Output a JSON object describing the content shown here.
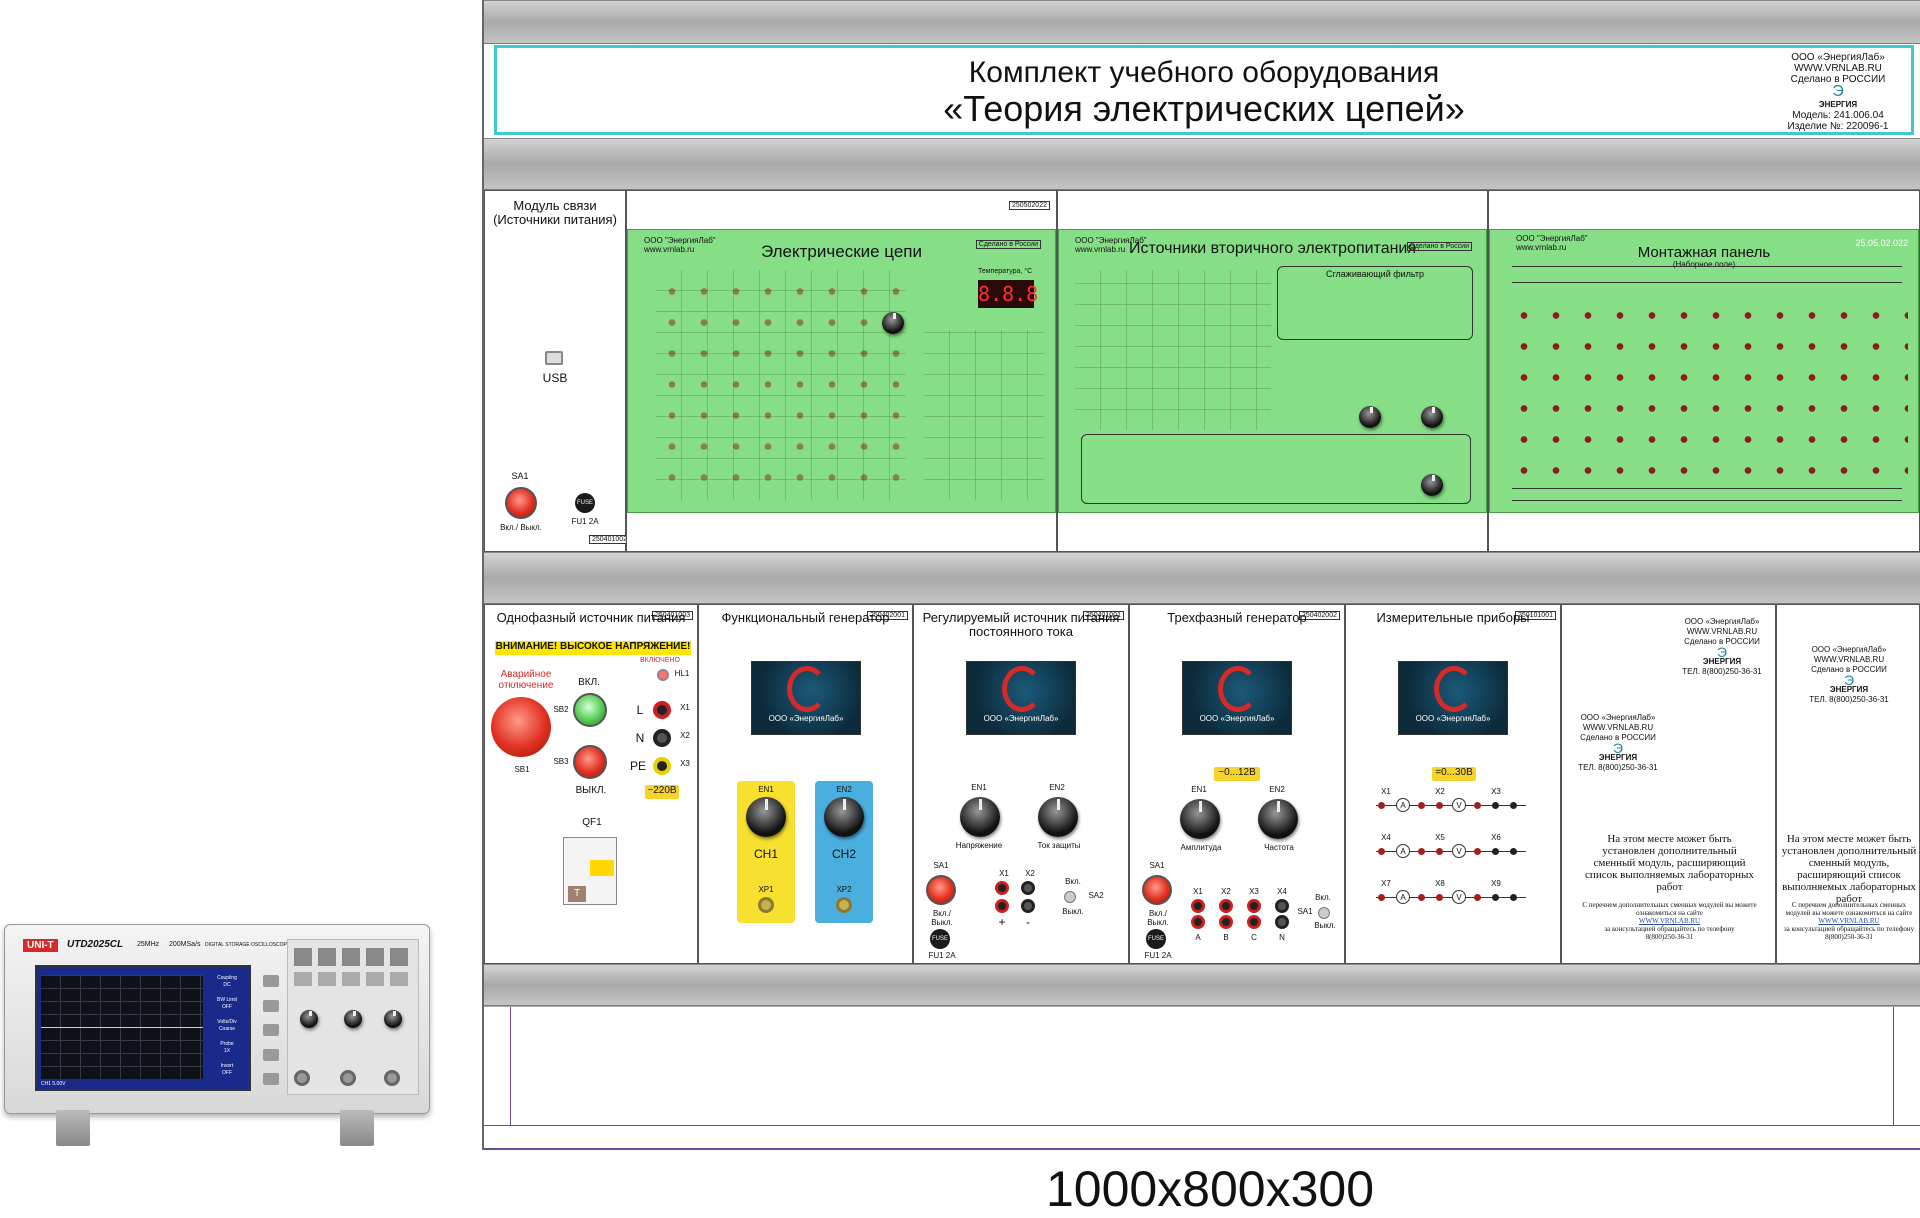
{
  "title": {
    "line1": "Комплект учебного оборудования",
    "line2": "«Теория электрических цепей»"
  },
  "company_block": {
    "name": "ООО «ЭнергияЛаб»",
    "site": "WWW.VRNLAB.RU",
    "made": "Сделано в РОССИИ",
    "brand": "ЭНЕРГИЯ",
    "model": "Модель: 241.006.04",
    "serial": "Изделие №: 220096-1"
  },
  "module_comm": {
    "title": "Модуль связи (Источники питания)",
    "usb": "USB",
    "sa1": "SA1",
    "sa1_state": "Вкл./ Выкл.",
    "fuse_label": "FU1 2А",
    "fuse_text": "FUSE",
    "code": "250401002"
  },
  "green_panels": [
    {
      "title": "Электрические цепи",
      "company": "ООО \"ЭнергияЛаб\" www.vrnlab.ru",
      "made": "Сделано в России",
      "code": "250502022",
      "temp": "8.8.8",
      "temp_label": "Температура, °С"
    },
    {
      "title": "Источники вторичного электропитания",
      "company": "ООО \"ЭнергияЛаб\" www.vrnlab.ru",
      "made": "Сделано в России",
      "filter": "Сглаживающий фильтр"
    },
    {
      "title": "Монтажная панель",
      "subtitle": "(Наборное поле)",
      "company": "ООО \"ЭнергияЛаб\" www.vrnlab.ru",
      "code": "25.05.02.022"
    }
  ],
  "single_phase": {
    "title": "Однофазный источник питания",
    "code": "250401003",
    "warning": "ВНИМАНИЕ!   ВЫСОКОЕ НАПРЯЖЕНИЕ!",
    "emergency": "Аварийное отключение",
    "on": "ВКЛ.",
    "off": "ВЫКЛ.",
    "sb1": "SB1",
    "sb2": "SB2",
    "sb3": "SB3",
    "indicator": "ВКЛЮЧЕНО",
    "hl1": "HL1",
    "l": "L",
    "n": "N",
    "pe": "PE",
    "x1": "X1",
    "x2": "X2",
    "x3": "X3",
    "voltage": "~220В",
    "qf1": "QF1",
    "t": "T"
  },
  "func_gen": {
    "title": "Функциональный генератор",
    "code": "250402001",
    "en1": "EN1",
    "en2": "EN2",
    "ch1": "CH1",
    "ch2": "CH2",
    "xp1": "XP1",
    "xp2": "XP2",
    "logo": "ООО «ЭнергияЛаб»"
  },
  "dc_source": {
    "title": "Регулируемый источник питания постоянного тока",
    "code": "250401001",
    "en1": "EN1",
    "en2": "EN2",
    "voltage": "Напряжение",
    "current": "Ток защиты",
    "sa1": "SA1",
    "sa1_state": "Вкл./ Выкл.",
    "x1": "X1",
    "x2": "X2",
    "plus": "+",
    "minus": "-",
    "sa2_on": "Вкл.",
    "sa2_off": "Выкл.",
    "sa2": "SA2",
    "fuse": "FU1 2А",
    "fuse_text": "FUSE",
    "logo": "ООО «ЭнергияЛаб»"
  },
  "three_phase": {
    "title": "Трехфазный генератор",
    "code": "250402002",
    "range": "~0...12В",
    "en1": "EN1",
    "en2": "EN2",
    "amp": "Амплитуда",
    "freq": "Частота",
    "sa1": "SA1",
    "sa1_state": "Вкл./ Выкл.",
    "xs": [
      "X1",
      "X2",
      "X3",
      "X4"
    ],
    "phases": [
      "A",
      "B",
      "C",
      "N"
    ],
    "sa_on": "Вкл.",
    "sa_off": "Выкл.",
    "sa1b": "SA1",
    "fuse": "FU1 2А",
    "fuse_text": "FUSE",
    "logo": "ООО «ЭнергияЛаб»"
  },
  "meters": {
    "title": "Измерительные приборы",
    "code": "250101001",
    "range": "=0...30В",
    "rows": [
      [
        "X1",
        "X2",
        "X3"
      ],
      [
        "X4",
        "X5",
        "X6"
      ],
      [
        "X7",
        "X8",
        "X9"
      ]
    ],
    "a": "A",
    "v": "V",
    "logo": "ООО «ЭнергияЛаб»"
  },
  "spare": {
    "company": "ООО «ЭнергияЛаб»",
    "site": "WWW.VRNLAB.RU",
    "made": "Сделано в РОССИИ",
    "brand": "ЭНЕРГИЯ",
    "phone": "ТЕЛ. 8(800)250-36-31",
    "main_text": "На этом месте может быть установлен дополнительный сменный модуль, расширяющий список выполняемых лабораторных работ",
    "small_text": "С перечнем дополнительных сменных модулей вы можете ознакомиться на сайте",
    "small_link": "WWW.VRNLAB.RU",
    "small_text2": "за консультацией обращайтесь по телефону",
    "small_phone": "8(800)250-36-31"
  },
  "oscilloscope": {
    "brand": "UNI-T",
    "model": "UTD2025CL",
    "spec1": "25MHz",
    "spec2": "200MSa/s",
    "type": "DIGITAL STORAGE OSCILLOSCOPE",
    "menu": [
      "Coupling",
      "DC",
      "BW Limit",
      "OFF",
      "Volts/Div",
      "Coarse",
      "Probe",
      "1X",
      "Invert",
      "OFF"
    ],
    "ch_info": "CH1 5.00V"
  },
  "dimensions": "1000х800х300"
}
